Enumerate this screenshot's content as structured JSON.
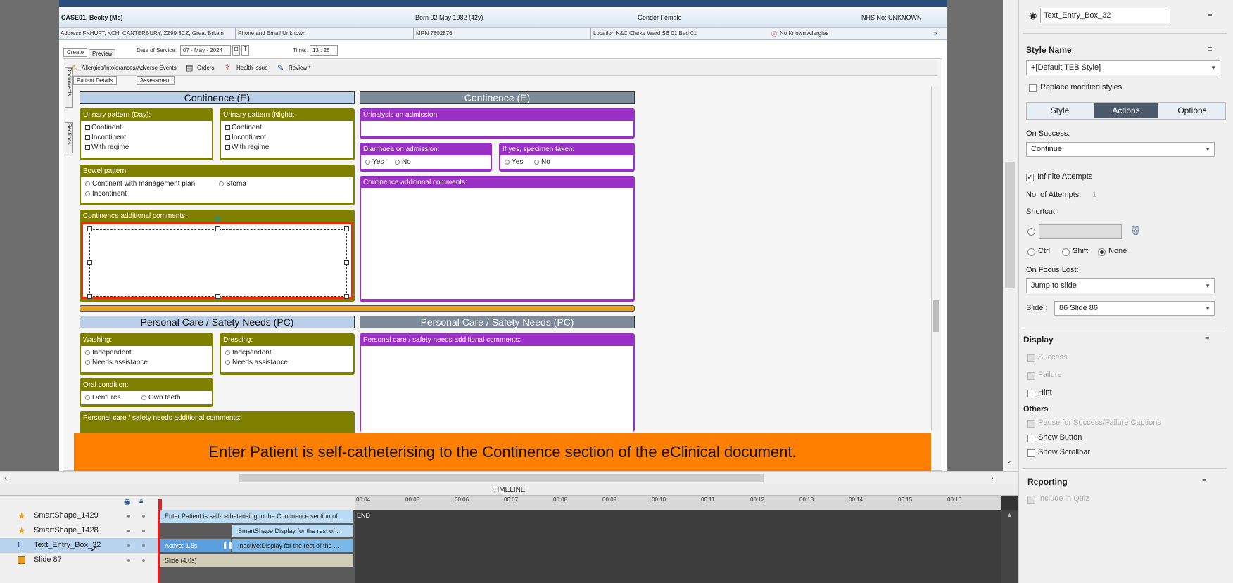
{
  "patient": {
    "name": "CASE01, Becky (Ms)",
    "born": "Born 02 May 1982 (42y)",
    "gender": "Gender Female",
    "nhs": "NHS No: UNKNOWN",
    "address": "Address FKHUFT, KCH, CANTERBURY, ZZ99 3CZ, Great Britain",
    "phone": "Phone and Email Unknown",
    "mrn": "MRN 7802876",
    "location": "Location K&C Clarke Ward SB 01 Bed 01",
    "allergies": "No Known Allergies"
  },
  "form": {
    "tab_create": "Create",
    "tab_preview": "Preview",
    "date_label": "Date of Service:",
    "date_value": "07 - May - 2024",
    "time_label": "Time:",
    "time_value": "13 : 26",
    "toolbar_allergies": "Allergies/Intolerances/Adverse Events",
    "toolbar_orders": "Orders",
    "toolbar_health": "Health Issue",
    "toolbar_review": "Review *",
    "subtab_details": "Patient Details",
    "subtab_assessment": "Assessment",
    "side_documents": "Documents",
    "side_sections": "Sections"
  },
  "continence": {
    "title_left": "Continence (E)",
    "title_right": "Continence (E)",
    "day_label": "Urinary pattern (Day):",
    "night_label": "Urinary pattern (Night):",
    "opt1": "Continent",
    "opt2": "Incontinent",
    "opt3": "With regime",
    "bowel_label": "Bowel pattern:",
    "bowel_opt1": "Continent with management plan",
    "bowel_opt2": "Stoma",
    "bowel_opt3": "Incontinent",
    "comments_label": "Continence additional comments:",
    "urinalysis_label": "Urinalysis on admission:",
    "diarrhoea_label": "Diarrhoea on admission:",
    "specimen_label": "If yes, specimen taken:",
    "yes": "Yes",
    "no": "No",
    "right_comments_label": "Continence additional comments:"
  },
  "personal": {
    "title_left": "Personal Care / Safety Needs (PC)",
    "title_right": "Personal Care / Safety Needs (PC)",
    "washing_label": "Washing:",
    "dressing_label": "Dressing:",
    "independent": "Independent",
    "needs": "Needs assistance",
    "oral_label": "Oral condition:",
    "dentures": "Dentures",
    "own_teeth": "Own teeth",
    "comments_label": "Personal care / safety needs additional comments:",
    "right_comments_label": "Personal care / safety needs additional comments:"
  },
  "caption": "Enter Patient is self-catheterising to the Continence section of the eClinical document.",
  "timeline": {
    "title": "TIMELINE",
    "ticks": [
      "00:00",
      "00:01",
      "00:02",
      "00:03",
      "00:04",
      "00:05",
      "00:06",
      "00:07",
      "00:08",
      "00:09",
      "00:10",
      "00:11",
      "00:12",
      "00:13",
      "00:14",
      "00:15",
      "00:16"
    ],
    "end_label": "END",
    "rows": [
      {
        "name": "SmartShape_1429",
        "bar": "Enter Patient is self-catheterising to the Continence section of..."
      },
      {
        "name": "SmartShape_1428",
        "bar": "SmartShape:Display for the rest of ..."
      },
      {
        "name": "Text_Entry_Box_32",
        "bar_active": "Active: 1.5s",
        "bar_inactive": "Inactive:Display for the rest of the ..."
      },
      {
        "name": "Slide 87",
        "bar": "Slide (4.0s)"
      }
    ]
  },
  "panel": {
    "object_name": "Text_Entry_Box_32",
    "style_name_label": "Style Name",
    "style_value": "+[Default TEB Style]",
    "replace_label": "Replace modified styles",
    "tabs": [
      "Style",
      "Actions",
      "Options"
    ],
    "on_success_label": "On Success:",
    "on_success_value": "Continue",
    "infinite_label": "Infinite Attempts",
    "attempts_label": "No. of Attempts:",
    "attempts_value": "1",
    "shortcut_label": "Shortcut:",
    "ctrl": "Ctrl",
    "shift": "Shift",
    "none": "None",
    "focus_lost_label": "On Focus Lost:",
    "focus_lost_value": "Jump to slide",
    "slide_label": "Slide :",
    "slide_value": "86 Slide 86",
    "display_label": "Display",
    "success": "Success",
    "failure": "Failure",
    "hint": "Hint",
    "others_label": "Others",
    "pause": "Pause for Success/Failure Captions",
    "show_button": "Show Button",
    "show_scrollbar": "Show Scrollbar",
    "reporting_label": "Reporting",
    "include_quiz": "Include in Quiz"
  }
}
